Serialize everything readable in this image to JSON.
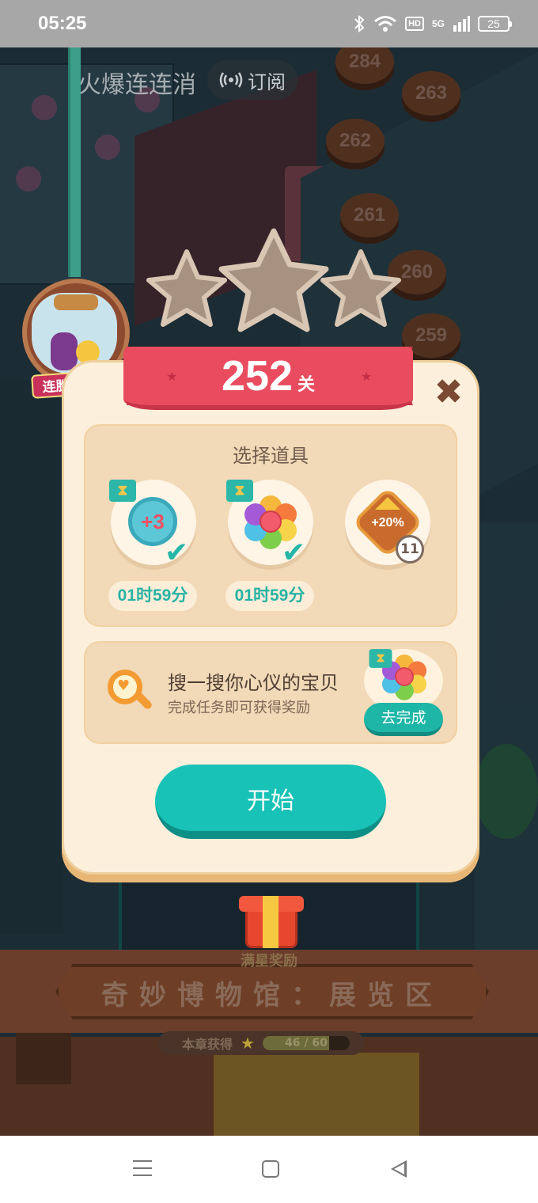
{
  "status_bar": {
    "time": "05:25",
    "hd": "HD",
    "network": "5G",
    "battery": "25",
    "icons": [
      "bluetooth-icon",
      "wifi-icon",
      "signal-icon",
      "battery-icon"
    ]
  },
  "header": {
    "game_title": "火爆连连消",
    "subscribe_label": "订阅"
  },
  "map": {
    "level_nodes": [
      "284",
      "263",
      "262",
      "261",
      "260",
      "259"
    ]
  },
  "jar_reward": {
    "label": "连胜得奖励"
  },
  "dialog": {
    "level_number": "252",
    "level_unit": "关",
    "stars_earned": 0,
    "stars_total": 3,
    "items_title": "选择道具",
    "items": [
      {
        "name": "+3",
        "timer": "01时59分",
        "selected": true
      },
      {
        "name": "rainbow-flower",
        "timer": "01时59分",
        "selected": true
      },
      {
        "name": "+20%",
        "count": "11",
        "selected": false
      }
    ],
    "task": {
      "title": "搜一搜你心仪的宝贝",
      "subtitle": "完成任务即可获得奖励",
      "button": "去完成"
    },
    "start_button": "开始"
  },
  "bottom": {
    "full_star_reward": "满星奖励",
    "area_name": "奇妙博物馆：展览区",
    "chapter_label": "本章获得",
    "chapter_progress": "46 / 60",
    "chapter_fraction": 0.767
  },
  "colors": {
    "accent": "#18c2b6",
    "ribbon": "#e94c5f",
    "dialog_bg": "#fcefdc"
  }
}
